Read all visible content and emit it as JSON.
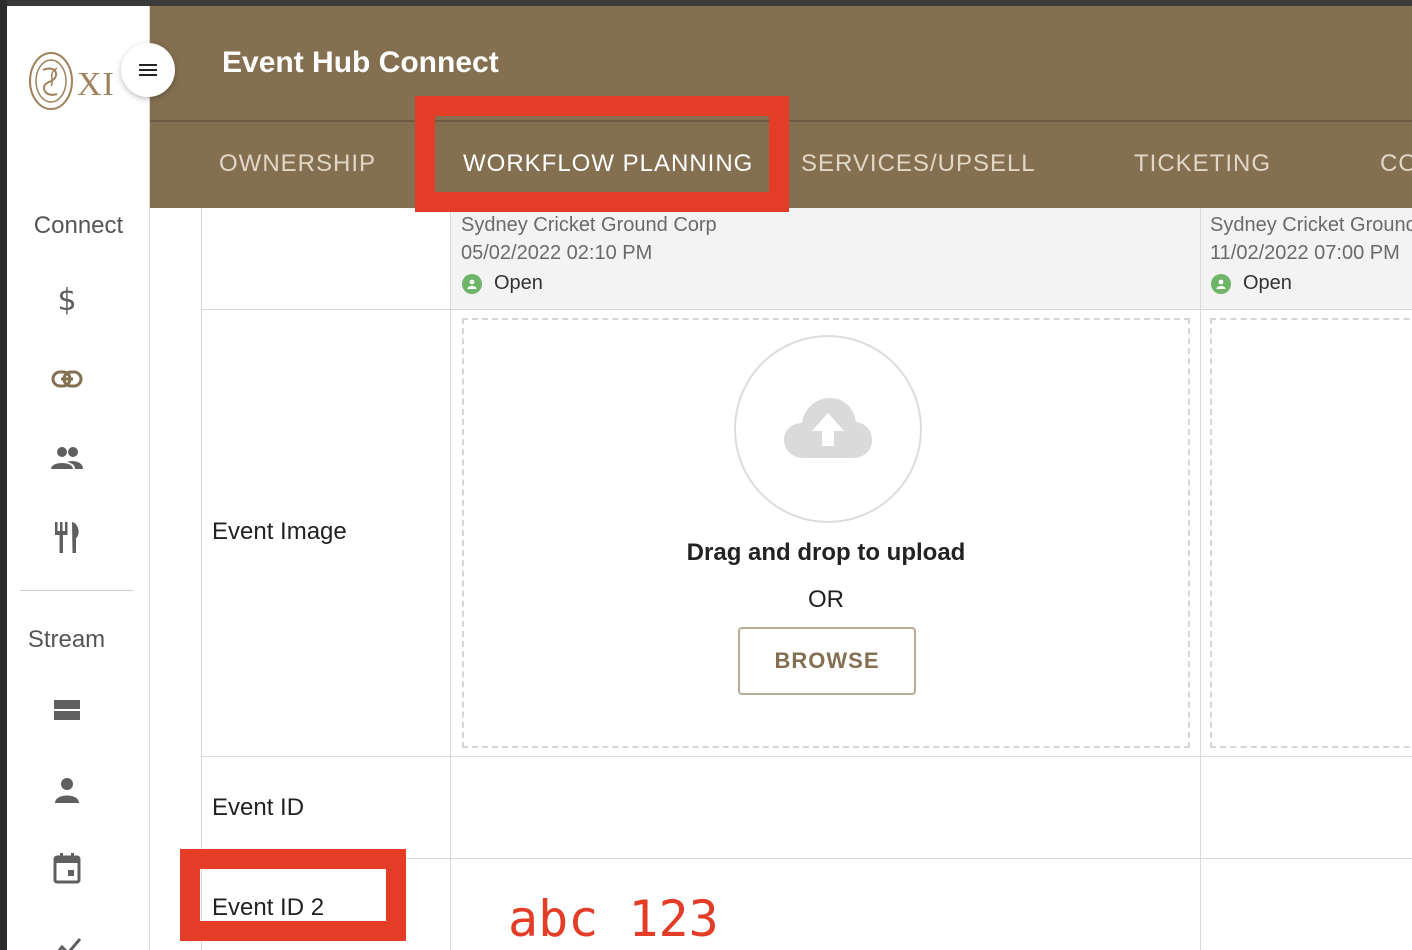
{
  "app": {
    "title": "Event Hub Connect",
    "logo_text": "XI",
    "accent_color": "#846f50"
  },
  "sidebar": {
    "section_connect": "Connect",
    "section_stream": "Stream",
    "connect_icons": [
      "dollar-icon",
      "link-icon",
      "people-icon",
      "restaurant-icon"
    ],
    "stream_icons": [
      "view-stream-icon",
      "person-icon",
      "calendar-icon",
      "chart-line-icon"
    ]
  },
  "tabs": [
    {
      "label": "OWNERSHIP",
      "active": false
    },
    {
      "label": "WORKFLOW PLANNING",
      "active": true
    },
    {
      "label": "SERVICES/UPSELL",
      "active": false
    },
    {
      "label": "TICKETING",
      "active": false
    },
    {
      "label": "CO",
      "active": false
    }
  ],
  "events": [
    {
      "org": "Sydney Cricket Ground Corp",
      "datetime": "05/02/2022 02:10 PM",
      "status": "Open"
    },
    {
      "org": "Sydney Cricket Ground",
      "datetime": "11/02/2022 07:00 PM",
      "status": "Open"
    }
  ],
  "rows": {
    "event_image": "Event Image",
    "event_id": "Event ID",
    "event_id_2": "Event ID 2"
  },
  "upload": {
    "drag_text": "Drag and drop to upload",
    "or_text": "OR",
    "browse_label": "BROWSE"
  },
  "annotation": {
    "text": "abc 123",
    "color": "#e43d27"
  }
}
